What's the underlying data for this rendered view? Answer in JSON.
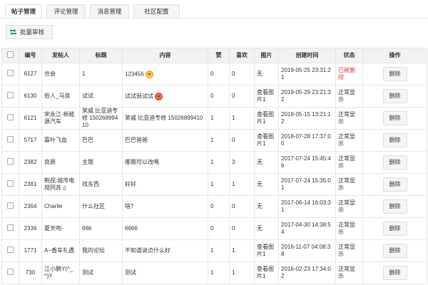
{
  "tabs": [
    "帖子管理",
    "评论管理",
    "消息管理",
    "社区配置"
  ],
  "toolbar": {
    "batch_label": "批量审核"
  },
  "columns": [
    "编号",
    "发帖人",
    "标题",
    "内容",
    "赞",
    "喜欢",
    "图片",
    "创建时间",
    "状态",
    "操作"
  ],
  "colors": {
    "deleted": "#e4393c",
    "header_bg": "#f2f2f2"
  },
  "rows": [
    {
      "id": "6127",
      "author": "也会",
      "title": "1",
      "content": "123456",
      "emoji": "smile-emoji",
      "likes": "0",
      "favs": "0",
      "image": "无",
      "time": "2019-05-25 23:31:21",
      "status": "已被删除",
      "action": "删除",
      "deleted": true
    },
    {
      "id": "6130",
      "author": "俗人_马良",
      "title": "试试",
      "content": "试试就试试",
      "emoji": "heart-eyes-emoji",
      "likes": "0",
      "favs": "0",
      "image": "查看图片1",
      "time": "2019-05-29 23:21:32",
      "status": "正常显示",
      "action": "删除"
    },
    {
      "id": "6121",
      "author": "宋永江-新能源汽车",
      "title": "荣威 比亚迪专修 15026899410",
      "content": "荣威 比亚迪专修 15026899410",
      "likes": "1",
      "favs": "1",
      "image": "查看图片1",
      "time": "2019-05-15 13:21:12",
      "status": "正常显示",
      "action": "删除"
    },
    {
      "id": "5717",
      "author": "寡叶飞血",
      "title": "巴巴",
      "content": "巴巴爸爸",
      "likes": "1",
      "favs": "0",
      "image": "查看图片1",
      "time": "2018-07-28 17:37:00",
      "status": "正常显示",
      "action": "删除"
    },
    {
      "id": "2382",
      "author": "良辰",
      "title": "主题",
      "content": "哪题可以改嗎",
      "likes": "1",
      "favs": "3",
      "image": "无",
      "time": "2017-07-24 15:45:46",
      "status": "正常显示",
      "action": "删除"
    },
    {
      "id": "2381",
      "author": "荆视.城市电视同苏 ▯",
      "title": "找东西",
      "content": "好好",
      "likes": "1",
      "favs": "1",
      "image": "无",
      "time": "2017-07-24 15:35:01",
      "status": "正常显示",
      "action": "删除"
    },
    {
      "id": "2364",
      "author": "Charlie",
      "title": "什么社区",
      "content": "啥?",
      "likes": "0",
      "favs": "0",
      "image": "无",
      "time": "2017-06-14 16:03:31",
      "status": "正常显示",
      "action": "删除"
    },
    {
      "id": "2336",
      "author": "夏天吻-",
      "title": "666",
      "content": "6666",
      "likes": "0",
      "favs": "0",
      "image": "无",
      "time": "2017-04-30 14:38:54",
      "status": "正常显示",
      "action": "删除"
    },
    {
      "id": "1771",
      "author": "A~香车礼遇",
      "title": "我的论坛",
      "content": "不知道说点什么好",
      "likes": "1",
      "favs": "1",
      "image": "查看图片1",
      "time": "2016-11-07 04:08:38",
      "status": "正常显示",
      "action": "删除"
    },
    {
      "id": "730",
      "author": "江小鹏Y(^_^)Y",
      "title": "测试",
      "content": "测试",
      "likes": "1",
      "favs": "1",
      "image": "查看图片1",
      "time": "2016-02-23 17:34:02",
      "status": "正常显示",
      "action": "删除"
    }
  ]
}
